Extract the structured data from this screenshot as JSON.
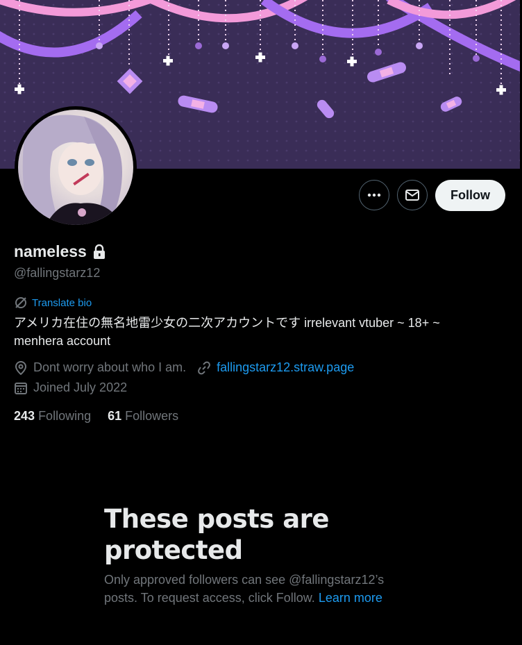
{
  "profile": {
    "name": "nameless",
    "handle": "@fallingstarz12",
    "translate_label": "Translate bio",
    "bio": "アメリカ在住の無名地雷少女の二次アカウントです irrelevant vtuber ~ 18+ ~ menhera account",
    "location": "Dont worry about who I am.",
    "website": "fallingstarz12.straw.page",
    "joined": "Joined July 2022",
    "following_count": "243",
    "following_label": "Following",
    "followers_count": "61",
    "followers_label": "Followers"
  },
  "actions": {
    "more_icon": "more-icon",
    "message_icon": "mail-icon",
    "follow_label": "Follow"
  },
  "protected": {
    "title": "These posts are protected",
    "desc": "Only approved followers can see @fallingstarz12’s posts. To request access, click Follow.",
    "learn_more": "Learn more"
  },
  "colors": {
    "background": "#000000",
    "banner": "#3a2d57",
    "accent": "#1d9bf0",
    "muted_text": "#71767b",
    "primary_text": "#e7e9ea"
  }
}
